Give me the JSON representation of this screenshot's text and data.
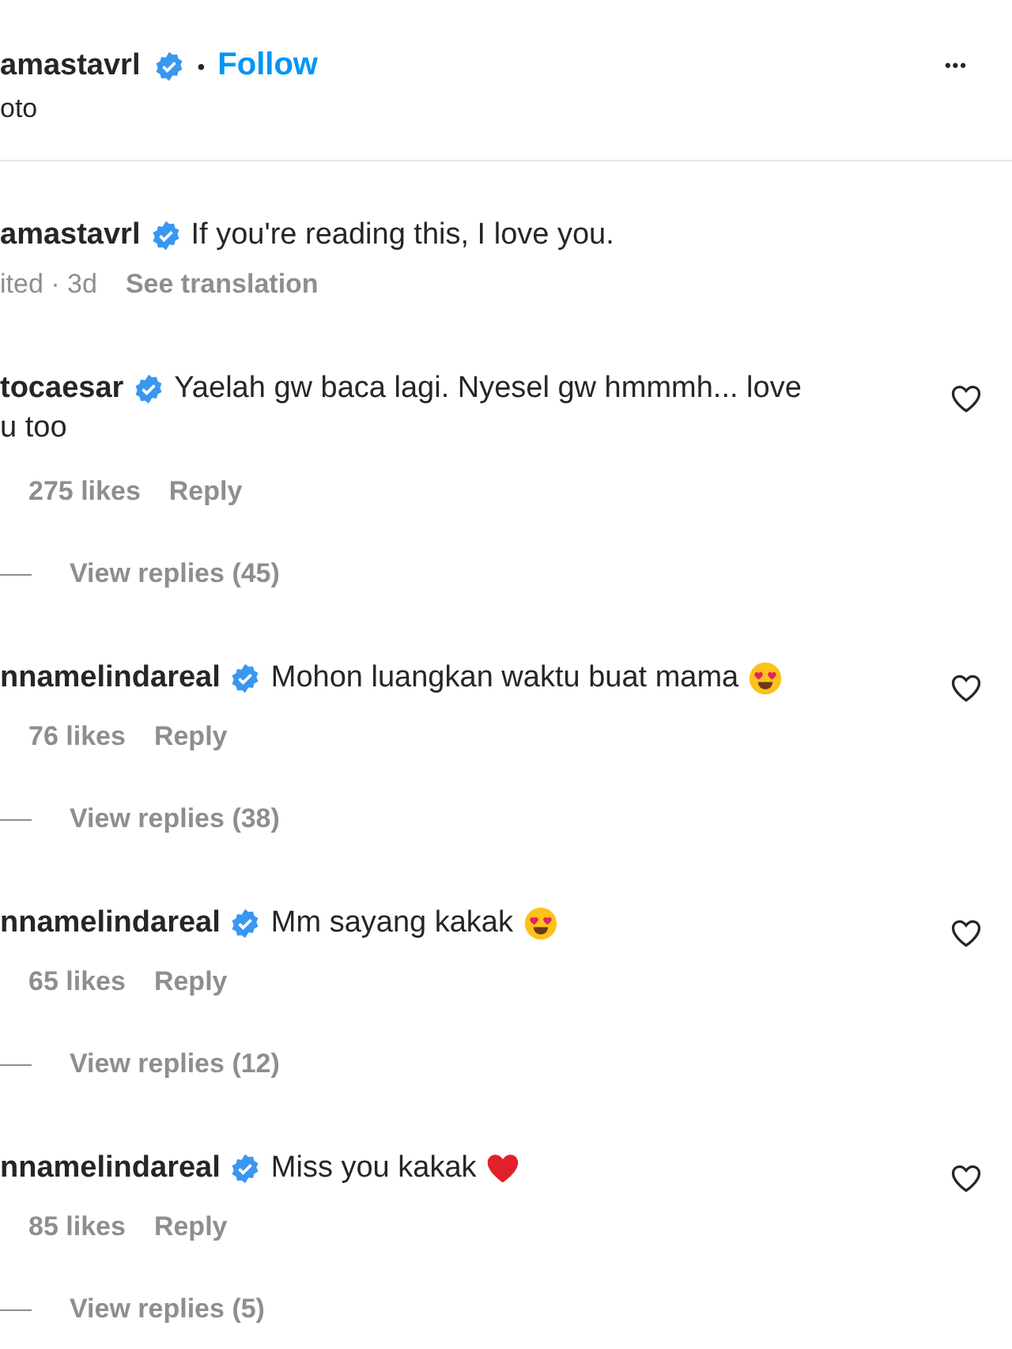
{
  "header": {
    "username": "amastavrl",
    "verified": true,
    "separator": "•",
    "follow": "Follow",
    "subtitle": "oto",
    "more": "•••"
  },
  "caption": {
    "username": "amastavrl",
    "verified": true,
    "text": "If you're reading this, I love you.",
    "meta": "ited · 3d",
    "translate": "See translation"
  },
  "comments": [
    {
      "username": "tocaesar",
      "verified": true,
      "lines": [
        "Yaelah gw baca lagi. Nyesel gw hmmmh... love",
        "u too"
      ],
      "kind": "plain",
      "likes": "275 likes",
      "reply": "Reply",
      "view_replies": "View replies (45)",
      "liked": false
    },
    {
      "username": "nnamelindareal",
      "verified": true,
      "lines": [
        "Mohon luangkan waktu buat mama"
      ],
      "kind": "heart_eyes",
      "likes": "76 likes",
      "reply": "Reply",
      "view_replies": "View replies (38)",
      "liked": false
    },
    {
      "username": "nnamelindareal",
      "verified": true,
      "lines": [
        "Mm sayang kakak"
      ],
      "kind": "heart_eyes",
      "likes": "65 likes",
      "reply": "Reply",
      "view_replies": "View replies (12)",
      "liked": false
    },
    {
      "username": "nnamelindareal",
      "verified": true,
      "lines": [
        "Miss you kakak"
      ],
      "kind": "red_heart",
      "likes": "85 likes",
      "reply": "Reply",
      "view_replies": "View replies (5)",
      "liked": false
    }
  ]
}
